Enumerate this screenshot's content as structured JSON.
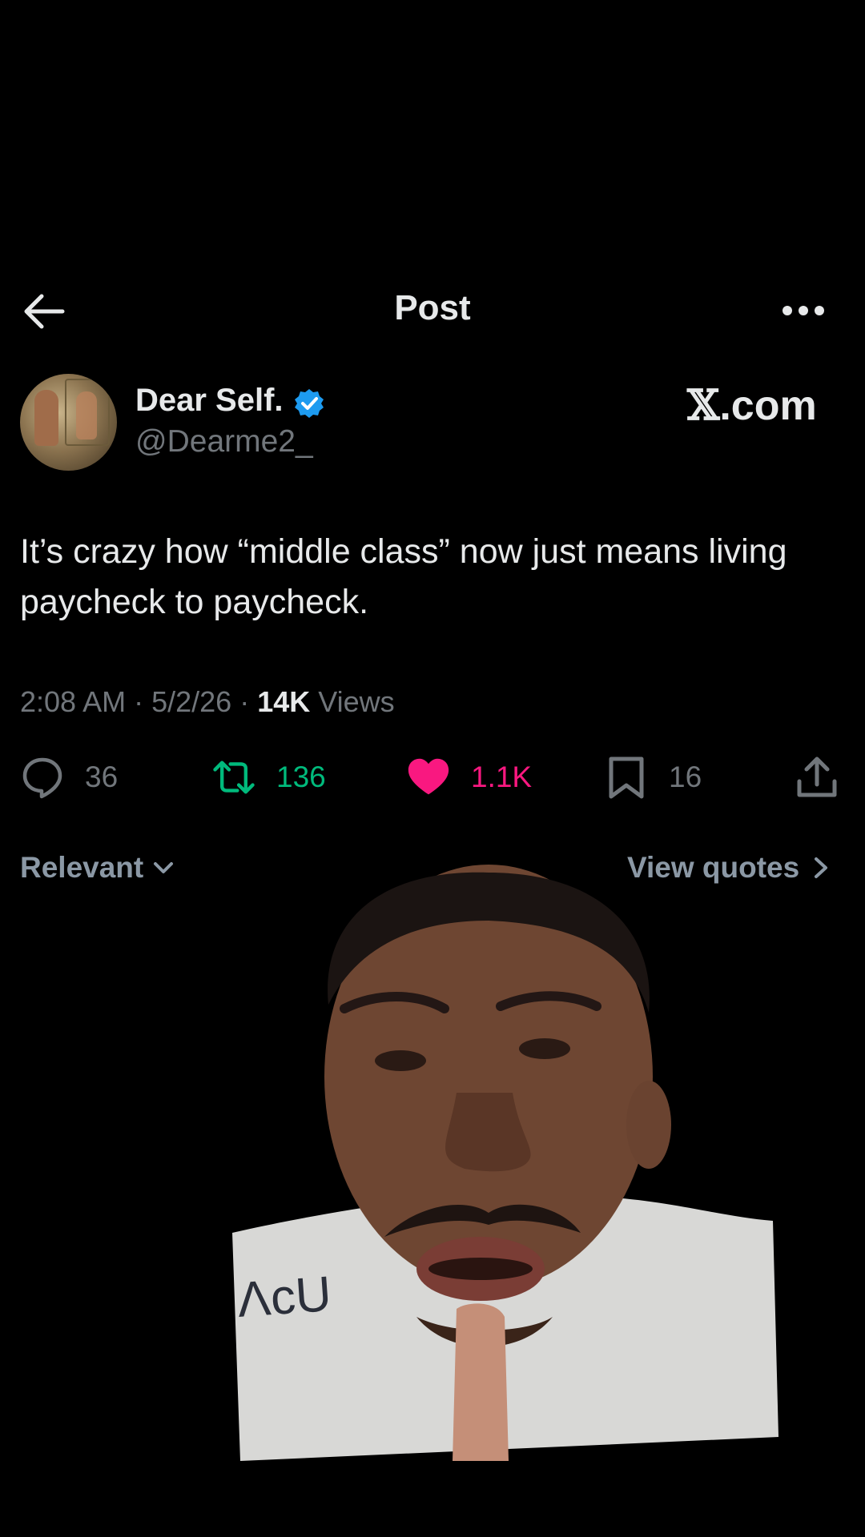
{
  "header": {
    "title": "Post"
  },
  "author": {
    "name": "Dear Self.",
    "handle": "@Dearme2_",
    "watermark": "X.com",
    "watermark_x": "𝕏",
    "watermark_rest": ".com"
  },
  "post": {
    "text": "It’s crazy how “middle class” now just means living paycheck to paycheck.",
    "time": "2:08 AM",
    "date": "5/2/26",
    "views_count": "14K",
    "views_label": "Views"
  },
  "actions": {
    "replies": "36",
    "reposts": "136",
    "likes": "1.1K",
    "bookmarks": "16"
  },
  "replies_bar": {
    "sort_label": "Relevant",
    "quotes_label": "View quotes"
  },
  "overlay": {
    "shirt_text": "ΛcU"
  },
  "colors": {
    "background": "#000000",
    "text": "#e7e9ea",
    "muted": "#71767b",
    "repost": "#00ba7c",
    "like": "#f91880",
    "verified": "#1d9bf0"
  },
  "icons": [
    "back-arrow-icon",
    "more-icon",
    "verified-badge-icon",
    "reply-icon",
    "repost-icon",
    "like-icon",
    "bookmark-icon",
    "share-icon",
    "chevron-down-icon",
    "chevron-right-icon"
  ]
}
